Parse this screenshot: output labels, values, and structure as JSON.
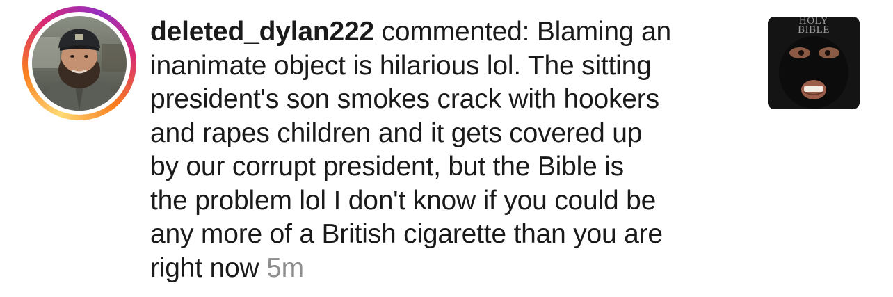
{
  "notification": {
    "username": "deleted_dylan222",
    "action": "commented:",
    "comment_lines": [
      "Blaming an",
      "inanimate object is hilarious lol. The sitting",
      "president's son smokes crack with hookers",
      "and rapes children and it gets covered up",
      "by our corrupt president, but the Bible is",
      "the problem lol I don't know if you could be",
      "any more of a British cigarette than you are",
      "right now"
    ],
    "timestamp": "5m",
    "thumbnail_text": [
      "HOLY",
      "BIBLE"
    ],
    "icons": {
      "avatar": "user-avatar",
      "thumbnail": "post-thumbnail"
    },
    "colors": {
      "text": "#1a1a1a",
      "timestamp": "#8e8e8e",
      "story_ring_start": "#feda75",
      "story_ring_end": "#d62976"
    }
  }
}
